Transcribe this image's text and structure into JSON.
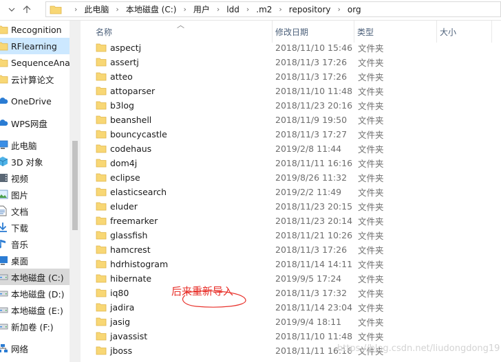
{
  "address": {
    "crumbs": [
      "此电脑",
      "本地磁盘 (C:)",
      "用户",
      "ldd",
      ".m2",
      "repository",
      "org"
    ]
  },
  "sidebar": {
    "items": [
      {
        "label": "Recognition",
        "icon": "folder-icon"
      },
      {
        "label": "RFlearning",
        "icon": "folder-icon",
        "state": "selected"
      },
      {
        "label": "SequenceAna",
        "icon": "folder-icon"
      },
      {
        "label": "云计算论文",
        "icon": "folder-icon"
      },
      {
        "label": "OneDrive",
        "icon": "cloud-icon"
      },
      {
        "label": "WPS网盘",
        "icon": "cloud-icon"
      },
      {
        "label": "此电脑",
        "icon": "computer-icon"
      },
      {
        "label": "3D 对象",
        "icon": "cube-icon"
      },
      {
        "label": "视频",
        "icon": "video-icon"
      },
      {
        "label": "图片",
        "icon": "picture-icon"
      },
      {
        "label": "文档",
        "icon": "document-icon"
      },
      {
        "label": "下载",
        "icon": "download-icon"
      },
      {
        "label": "音乐",
        "icon": "music-icon"
      },
      {
        "label": "桌面",
        "icon": "desktop-icon"
      },
      {
        "label": "本地磁盘 (C:)",
        "icon": "drive-icon",
        "state": "current"
      },
      {
        "label": "本地磁盘 (D:)",
        "icon": "drive-icon"
      },
      {
        "label": "本地磁盘 (E:)",
        "icon": "drive-icon"
      },
      {
        "label": "新加卷 (F:)",
        "icon": "drive-icon"
      },
      {
        "label": "网络",
        "icon": "network-icon"
      }
    ]
  },
  "columns": {
    "name": "名称",
    "modified": "修改日期",
    "type": "类型",
    "size": "大小"
  },
  "files": [
    {
      "name": "aspectj",
      "modified": "2018/11/10 15:46",
      "type": "文件夹"
    },
    {
      "name": "assertj",
      "modified": "2018/11/3 17:26",
      "type": "文件夹"
    },
    {
      "name": "atteo",
      "modified": "2018/11/3 17:26",
      "type": "文件夹"
    },
    {
      "name": "attoparser",
      "modified": "2018/11/10 11:48",
      "type": "文件夹"
    },
    {
      "name": "b3log",
      "modified": "2018/11/23 20:16",
      "type": "文件夹"
    },
    {
      "name": "beanshell",
      "modified": "2018/11/9 19:50",
      "type": "文件夹"
    },
    {
      "name": "bouncycastle",
      "modified": "2018/11/3 17:27",
      "type": "文件夹"
    },
    {
      "name": "codehaus",
      "modified": "2019/2/8 11:44",
      "type": "文件夹"
    },
    {
      "name": "dom4j",
      "modified": "2018/11/11 16:16",
      "type": "文件夹"
    },
    {
      "name": "eclipse",
      "modified": "2019/8/26 11:32",
      "type": "文件夹"
    },
    {
      "name": "elasticsearch",
      "modified": "2019/2/2 11:49",
      "type": "文件夹"
    },
    {
      "name": "eluder",
      "modified": "2018/11/23 20:15",
      "type": "文件夹"
    },
    {
      "name": "freemarker",
      "modified": "2018/11/23 20:14",
      "type": "文件夹"
    },
    {
      "name": "glassfish",
      "modified": "2018/11/21 10:26",
      "type": "文件夹"
    },
    {
      "name": "hamcrest",
      "modified": "2018/11/3 17:26",
      "type": "文件夹"
    },
    {
      "name": "hdrhistogram",
      "modified": "2018/11/14 14:11",
      "type": "文件夹"
    },
    {
      "name": "hibernate",
      "modified": "2019/9/5 17:24",
      "type": "文件夹"
    },
    {
      "name": "iq80",
      "modified": "2018/11/3 17:32",
      "type": "文件夹"
    },
    {
      "name": "jadira",
      "modified": "2018/11/14 23:04",
      "type": "文件夹"
    },
    {
      "name": "jasig",
      "modified": "2019/9/4 18:11",
      "type": "文件夹"
    },
    {
      "name": "javassist",
      "modified": "2018/11/10 11:48",
      "type": "文件夹"
    },
    {
      "name": "jboss",
      "modified": "2018/11/11 16:16",
      "type": "文件夹"
    }
  ],
  "annotation": {
    "text": "后来重新导入"
  },
  "watermark": "https://blog.csdn.net/liudongdong19"
}
